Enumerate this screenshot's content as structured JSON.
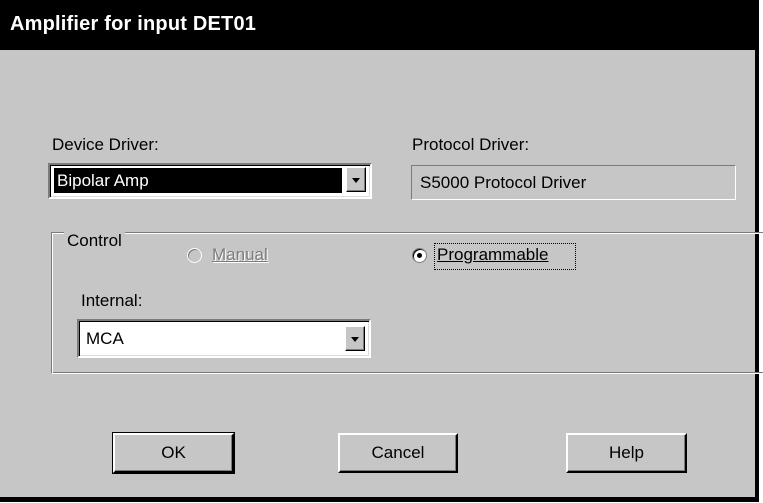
{
  "dialog": {
    "title": "Amplifier for input DET01"
  },
  "device_driver": {
    "label": "Device Driver:",
    "value": "Bipolar Amp"
  },
  "protocol_driver": {
    "label": "Protocol Driver:",
    "value": "S5000 Protocol Driver"
  },
  "control_group": {
    "legend": "Control",
    "manual": {
      "label": "Manual",
      "selected": false,
      "enabled": false
    },
    "programmable": {
      "label": "Programmable",
      "selected": true,
      "enabled": true
    },
    "internal": {
      "label": "Internal:",
      "value": "MCA"
    }
  },
  "buttons": {
    "ok": "OK",
    "cancel": "Cancel",
    "help": "Help"
  },
  "icons": {
    "dropdown": "chevron-down-icon",
    "radio_selected": "radio-selected-icon",
    "radio_unselected": "radio-unselected-icon"
  },
  "colors": {
    "dialog_face": "#c6c6c6",
    "titlebar": "#000000",
    "title_text": "#ffffff",
    "disabled_text": "#7b7b7b"
  }
}
